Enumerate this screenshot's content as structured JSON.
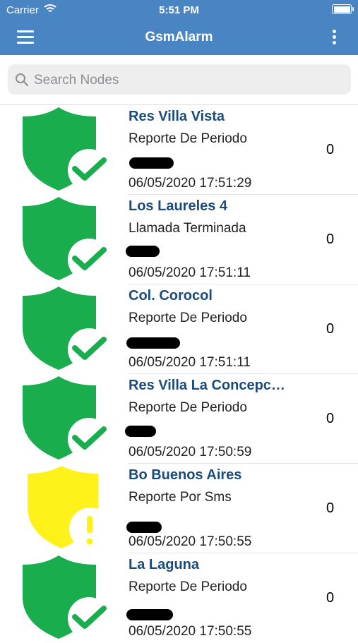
{
  "status_bar": {
    "carrier": "Carrier",
    "time": "5:51 PM"
  },
  "nav": {
    "title": "GsmAlarm"
  },
  "search": {
    "placeholder": "Search Nodes"
  },
  "colors": {
    "accent": "#4a85c3",
    "ok_green": "#1aad4e",
    "warn_yellow": "#fff21a"
  },
  "nodes": [
    {
      "name": "Res Villa Vista",
      "event": "Reporte De Periodo",
      "time": "06/05/2020 17:51:29",
      "count": "0",
      "status": "ok"
    },
    {
      "name": "Los Laureles 4",
      "event": "Llamada Terminada",
      "time": "06/05/2020 17:51:11",
      "count": "0",
      "status": "ok"
    },
    {
      "name": "Col. Corocol",
      "event": "Reporte De Periodo",
      "time": "06/05/2020 17:51:11",
      "count": "0",
      "status": "ok"
    },
    {
      "name": "Res Villa La Concepc…",
      "event": "Reporte De Periodo",
      "time": "06/05/2020 17:50:59",
      "count": "0",
      "status": "ok"
    },
    {
      "name": "Bo Buenos Aires",
      "event": "Reporte Por Sms",
      "time": "06/05/2020 17:50:55",
      "count": "0",
      "status": "warning"
    },
    {
      "name": "La Laguna",
      "event": "Reporte De Periodo",
      "time": "06/05/2020 17:50:55",
      "count": "0",
      "status": "ok"
    }
  ]
}
